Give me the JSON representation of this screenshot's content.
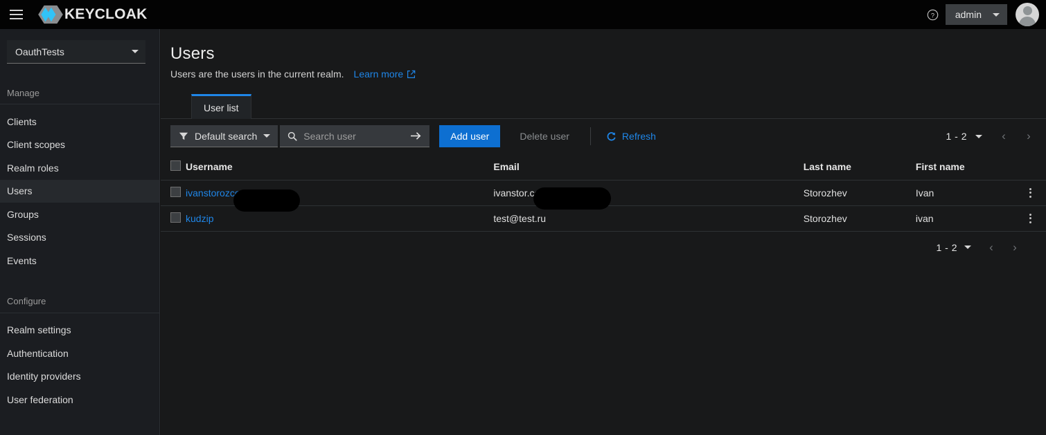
{
  "masthead": {
    "menu_icon": "hamburger-icon",
    "brand_text": "KEYCLOAK",
    "help_icon": "help-circle-icon",
    "admin_label": "admin",
    "avatar_icon": "user-avatar-icon"
  },
  "sidebar": {
    "realm": {
      "name": "OauthTests",
      "caret_icon": "chevron-down-icon"
    },
    "sections": [
      {
        "heading": "Manage",
        "items": [
          {
            "label": "Clients",
            "active": false
          },
          {
            "label": "Client scopes",
            "active": false
          },
          {
            "label": "Realm roles",
            "active": false
          },
          {
            "label": "Users",
            "active": true
          },
          {
            "label": "Groups",
            "active": false
          },
          {
            "label": "Sessions",
            "active": false
          },
          {
            "label": "Events",
            "active": false
          }
        ]
      },
      {
        "heading": "Configure",
        "items": [
          {
            "label": "Realm settings",
            "active": false
          },
          {
            "label": "Authentication",
            "active": false
          },
          {
            "label": "Identity providers",
            "active": false
          },
          {
            "label": "User federation",
            "active": false
          }
        ]
      }
    ]
  },
  "page": {
    "title": "Users",
    "subtitle": "Users are the users in the current realm.",
    "learn_more": "Learn more",
    "external_link_icon": "external-link-icon"
  },
  "tabs": [
    {
      "label": "User list",
      "active": true
    }
  ],
  "toolbar": {
    "filter_icon": "filter-icon",
    "filter_label": "Default search",
    "filter_caret_icon": "chevron-down-icon",
    "search_icon": "search-icon",
    "search_value": "",
    "search_placeholder": "Search user",
    "search_go_icon": "arrow-right-icon",
    "add_user_label": "Add user",
    "delete_user_label": "Delete user",
    "refresh_icon": "refresh-icon",
    "refresh_label": "Refresh"
  },
  "pagination_top": {
    "range": "1 - 2",
    "caret_icon": "chevron-down-icon",
    "prev_icon": "chevron-left-icon",
    "next_icon": "chevron-right-icon"
  },
  "pagination_bottom": {
    "range": "1 - 2",
    "caret_icon": "chevron-down-icon",
    "prev_icon": "chevron-left-icon",
    "next_icon": "chevron-right-icon"
  },
  "table": {
    "select_all_icon": "checkbox-icon",
    "columns": [
      "Username",
      "Email",
      "Last name",
      "First name"
    ],
    "rows": [
      {
        "username_prefix": "ivanstoroz",
        "username_suffix": "com",
        "username_redacted": true,
        "email_prefix": "ivanstor",
        "email_suffix": ".com",
        "email_redacted": true,
        "last_name": "Storozhev",
        "first_name": "Ivan",
        "kebab_icon": "kebab-menu-icon"
      },
      {
        "username_prefix": "kudzip",
        "username_suffix": "",
        "username_redacted": false,
        "email_prefix": "test@test.ru",
        "email_suffix": "",
        "email_redacted": false,
        "last_name": "Storozhev",
        "first_name": "ivan",
        "kebab_icon": "kebab-menu-icon"
      }
    ]
  },
  "colors": {
    "accent_blue": "#1f86e8",
    "primary_button": "#0d6fd1",
    "masthead_bg": "#030303",
    "sidebar_bg": "#1b1d21",
    "content_bg": "#18191a",
    "brand_cyan": "#31c3f7"
  }
}
